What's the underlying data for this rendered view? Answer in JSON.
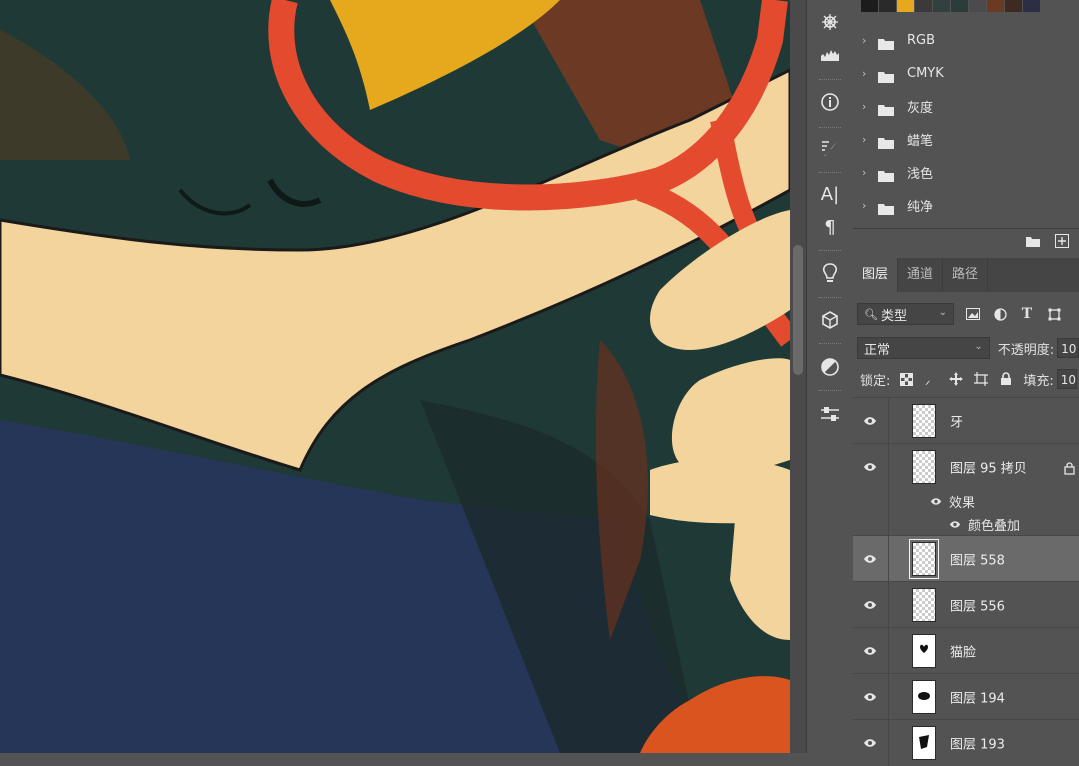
{
  "swatch_colors": [
    "#1c1c1c",
    "#2a2a2a",
    "#e6a91d",
    "#3a3a3a",
    "#334040",
    "#2b3c3a",
    "#4b4b4b",
    "#6a3a23",
    "#3d2a20",
    "#2c2e46"
  ],
  "swatch_groups": [
    "RGB",
    "CMYK",
    "灰度",
    "蜡笔",
    "浅色",
    "纯净"
  ],
  "tabs": [
    "图层",
    "通道",
    "路径"
  ],
  "filter": {
    "kind_label": "类型"
  },
  "blend": {
    "mode": "正常",
    "opacity_label": "不透明度:",
    "opacity_value": "10"
  },
  "lock": {
    "label": "锁定:",
    "fill_label": "填充:",
    "fill_value": "10"
  },
  "layers": [
    {
      "name": "牙"
    },
    {
      "name": "图层 95 拷贝",
      "effects_label": "效果",
      "effect_item": "颜色叠加"
    },
    {
      "name": "图层 558"
    },
    {
      "name": "图层 556"
    },
    {
      "name": "猫脸"
    },
    {
      "name": "图层 194"
    },
    {
      "name": "图层 193"
    }
  ],
  "colors": {
    "canvas_dark_green": "#1f3a36",
    "canvas_navy": "#263658",
    "canvas_cream": "#f3d49c",
    "canvas_red": "#e44a2d",
    "canvas_yellow": "#e6a91d",
    "canvas_rust": "#7a3a22",
    "canvas_orange": "#d9541f",
    "panel_bg": "#535353",
    "selected_row": "#6a6a6a"
  }
}
